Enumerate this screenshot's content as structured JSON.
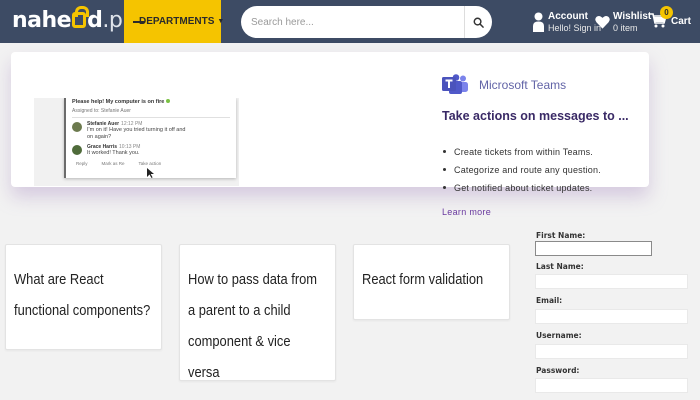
{
  "header": {
    "logo_main": "nahe",
    "logo_rest": "d",
    "logo_suffix": ".pk",
    "departments_label": "DEPARTMENTS",
    "search_placeholder": "Search here...",
    "account": {
      "title": "Account",
      "subtitle": "Hello! Sign in"
    },
    "wishlist": {
      "title": "Wishlist",
      "subtitle": "0 item"
    },
    "cart": {
      "title": "Cart",
      "count": "0"
    },
    "colors": {
      "bar": "#3d4b64",
      "accent": "#f5c400"
    }
  },
  "promo": {
    "brand": "Microsoft Teams",
    "title": "Take actions on messages to ...",
    "bullets": [
      "Create tickets from within Teams.",
      "Categorize and route any question.",
      "Get notified about ticket updates."
    ],
    "link": "Learn more",
    "screenshot": {
      "question": "Please help! My computer is on fire",
      "assigned": "Assigned to: Stefanie Auer",
      "messages": [
        {
          "name": "Stefanie Auer",
          "time": "12:12 PM",
          "text": "I'm on it! Have you tried turning it off and on again?"
        },
        {
          "name": "Grace Harris",
          "time": "10:13 PM",
          "text": "It worked! Thank you."
        }
      ],
      "actions": [
        "Reply",
        "Mark as Re",
        "Take action"
      ]
    }
  },
  "cards": [
    "What are React functional components?",
    "How to pass data from a parent to a child component & vice versa",
    "React form validation"
  ],
  "form": {
    "fields": [
      "First Name:",
      "Last Name:",
      "Email:",
      "Username:",
      "Password:"
    ]
  }
}
